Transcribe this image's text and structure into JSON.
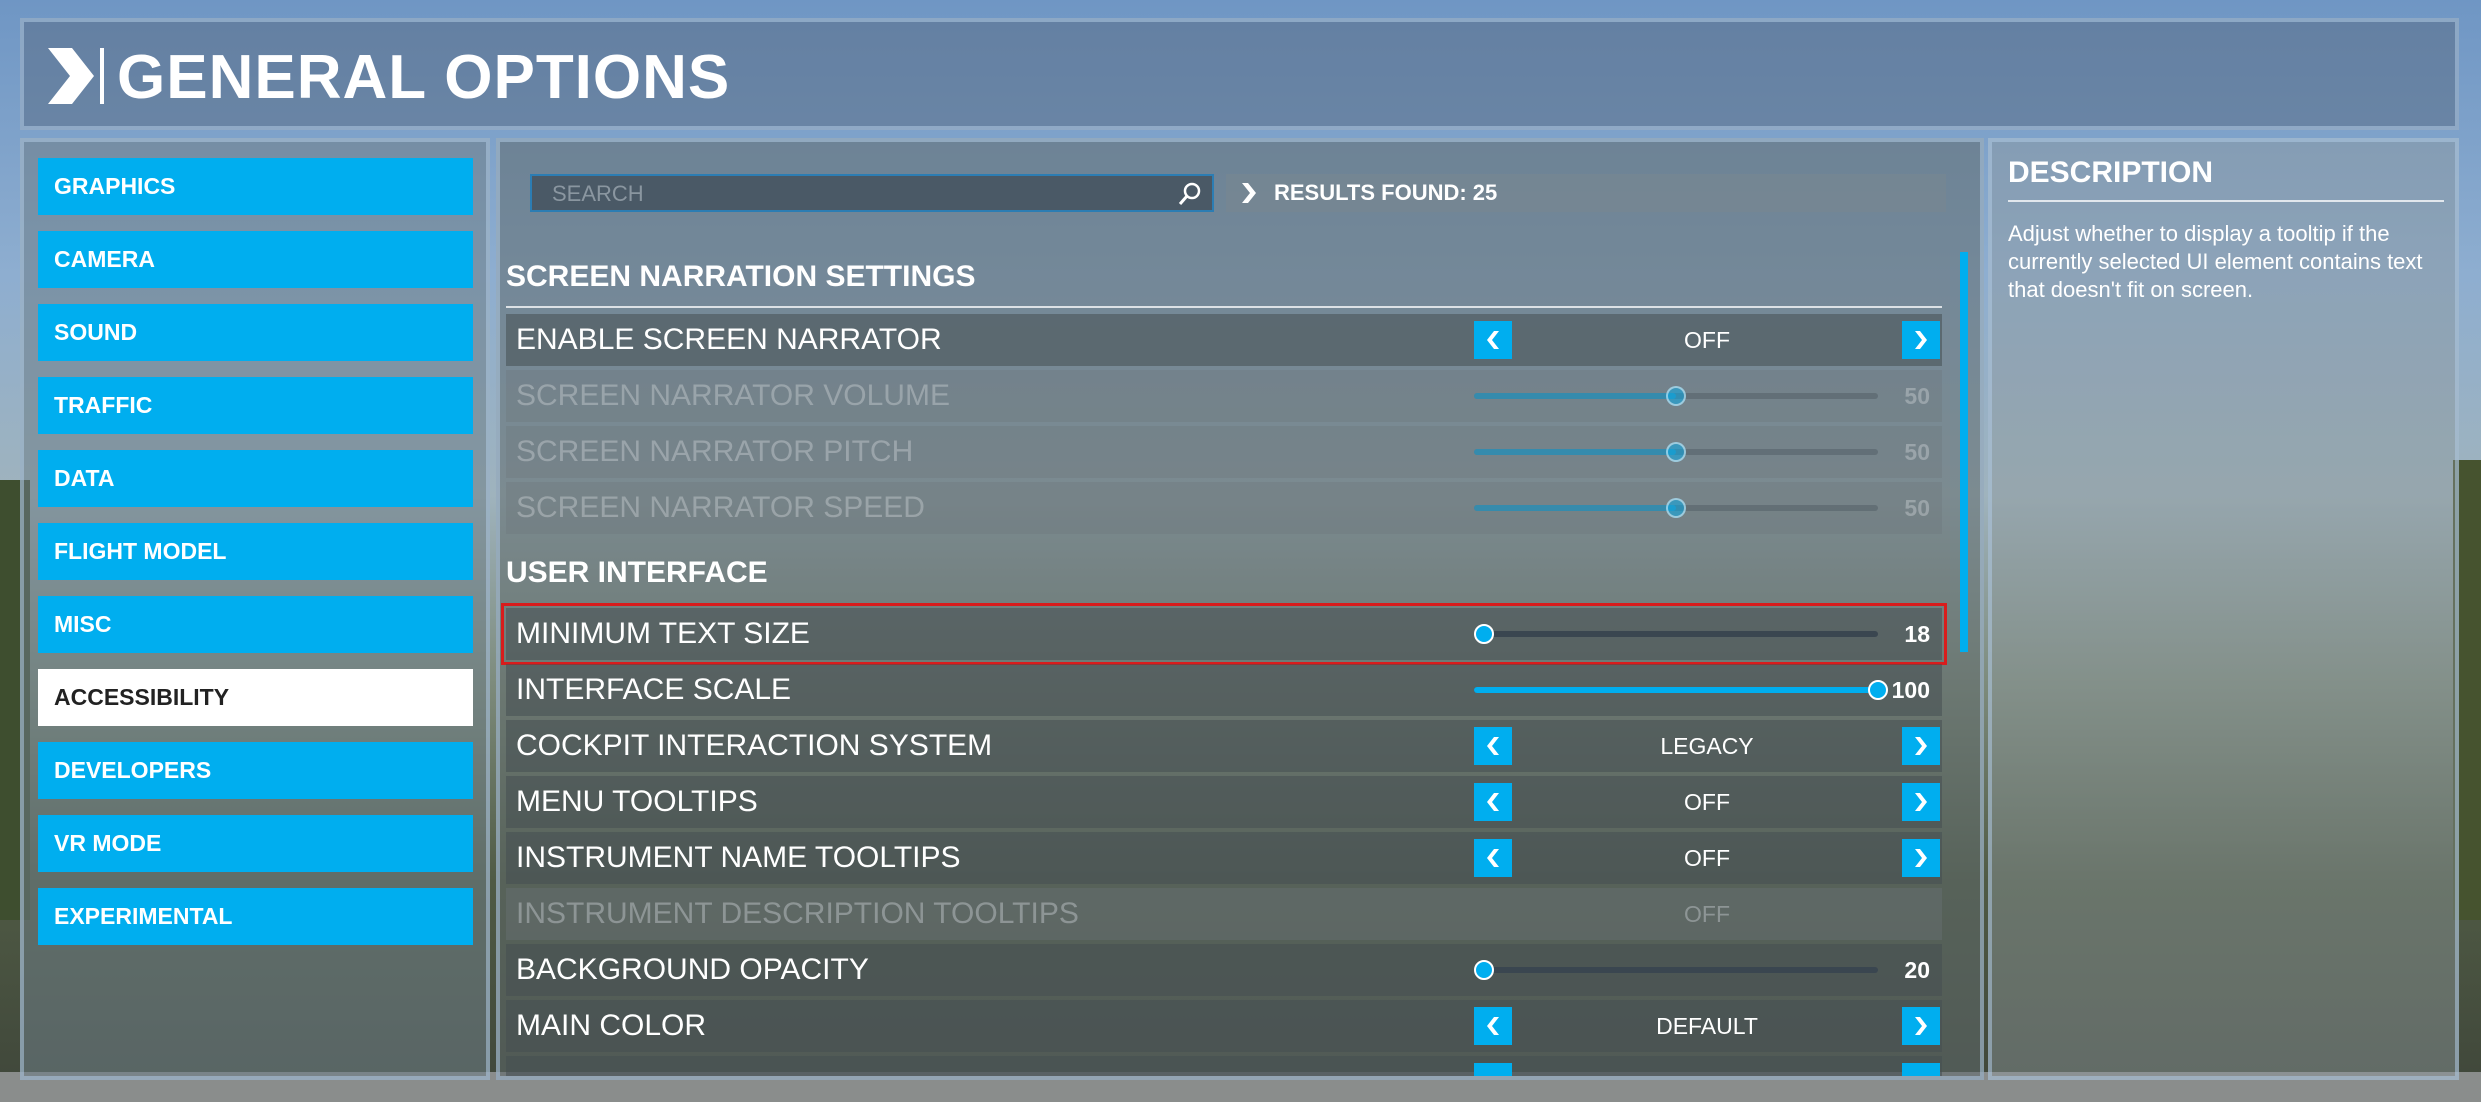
{
  "header": {
    "title": "GENERAL OPTIONS"
  },
  "sidebar": {
    "items": [
      {
        "label": "GRAPHICS",
        "active": false
      },
      {
        "label": "CAMERA",
        "active": false
      },
      {
        "label": "SOUND",
        "active": false
      },
      {
        "label": "TRAFFIC",
        "active": false
      },
      {
        "label": "DATA",
        "active": false
      },
      {
        "label": "FLIGHT MODEL",
        "active": false
      },
      {
        "label": "MISC",
        "active": false
      },
      {
        "label": "ACCESSIBILITY",
        "active": true
      },
      {
        "label": "DEVELOPERS",
        "active": false
      },
      {
        "label": "VR MODE",
        "active": false
      },
      {
        "label": "EXPERIMENTAL",
        "active": false
      }
    ]
  },
  "search": {
    "placeholder": "SEARCH",
    "value": ""
  },
  "results": {
    "label": "RESULTS FOUND: 25"
  },
  "sections": {
    "narration": {
      "title": "SCREEN NARRATION SETTINGS"
    },
    "ui": {
      "title": "USER INTERFACE"
    }
  },
  "settings": {
    "enable_screen_narrator": {
      "label": "ENABLE SCREEN NARRATOR",
      "value": "OFF"
    },
    "screen_narrator_volume": {
      "label": "SCREEN NARRATOR VOLUME",
      "value": "50",
      "fraction": 0.5,
      "disabled": true
    },
    "screen_narrator_pitch": {
      "label": "SCREEN NARRATOR PITCH",
      "value": "50",
      "fraction": 0.5,
      "disabled": true
    },
    "screen_narrator_speed": {
      "label": "SCREEN NARRATOR SPEED",
      "value": "50",
      "fraction": 0.5,
      "disabled": true
    },
    "minimum_text_size": {
      "label": "MINIMUM TEXT SIZE",
      "value": "18",
      "fraction": 0.0,
      "highlighted": true
    },
    "interface_scale": {
      "label": "INTERFACE SCALE",
      "value": "100",
      "fraction": 1.0
    },
    "cockpit_interaction_system": {
      "label": "COCKPIT INTERACTION SYSTEM",
      "value": "LEGACY"
    },
    "menu_tooltips": {
      "label": "MENU TOOLTIPS",
      "value": "OFF"
    },
    "instrument_name_tooltips": {
      "label": "INSTRUMENT NAME TOOLTIPS",
      "value": "OFF"
    },
    "instrument_description_tooltips": {
      "label": "INSTRUMENT DESCRIPTION TOOLTIPS",
      "value": "OFF",
      "disabled": true
    },
    "background_opacity": {
      "label": "BACKGROUND OPACITY",
      "value": "20",
      "fraction": 0.0
    },
    "main_color": {
      "label": "MAIN COLOR",
      "value": "DEFAULT"
    }
  },
  "description": {
    "title": "DESCRIPTION",
    "text": "Adjust whether to display a tooltip if the currently selected UI element contains text that doesn't fit on screen."
  },
  "colors": {
    "accent": "#00aeef",
    "highlight": "#d91c1c"
  }
}
